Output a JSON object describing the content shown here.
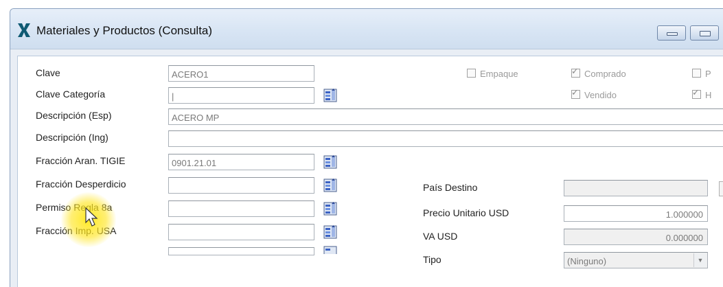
{
  "window": {
    "title": "Materiales y Productos (Consulta)",
    "icons": {
      "app": "app-x-logo-icon",
      "minimize": "minimize-icon",
      "restore": "restore-icon"
    }
  },
  "form": {
    "clave": {
      "label": "Clave",
      "value": "ACERO1"
    },
    "clave_categoria": {
      "label": "Clave Categoría",
      "value": "|"
    },
    "desc_esp": {
      "label": "Descripción (Esp)",
      "value": "ACERO MP"
    },
    "desc_ing": {
      "label": "Descripción (Ing)",
      "value": ""
    },
    "fraccion_tigie": {
      "label": "Fracción Aran. TIGIE",
      "value": "0901.21.01"
    },
    "fraccion_desperdicio": {
      "label": "Fracción Desperdicio",
      "value": ""
    },
    "permiso_regla": {
      "label": "Permiso Regla 8a",
      "value": ""
    },
    "fraccion_usa": {
      "label": "Fracción Imp. USA",
      "value": ""
    }
  },
  "checkboxes": {
    "empaque": {
      "label": "Empaque",
      "checked": false
    },
    "comprado": {
      "label": "Comprado",
      "checked": true
    },
    "vendido": {
      "label": "Vendido",
      "checked": true
    },
    "p_partial": {
      "label": "P",
      "checked": false
    },
    "h_partial": {
      "label": "H",
      "checked": true
    }
  },
  "right_panel": {
    "pais_destino": {
      "label": "País Destino",
      "value": ""
    },
    "precio_unitario": {
      "label": "Precio Unitario USD",
      "value": "1.000000"
    },
    "va_usd": {
      "label": "VA USD",
      "value": "0.000000"
    },
    "tipo": {
      "label": "Tipo",
      "value": "(Ninguno)"
    }
  },
  "colors": {
    "accent": "#0f5a73",
    "titlebar": "#d8e5f4",
    "highlight": "#ffe600"
  }
}
